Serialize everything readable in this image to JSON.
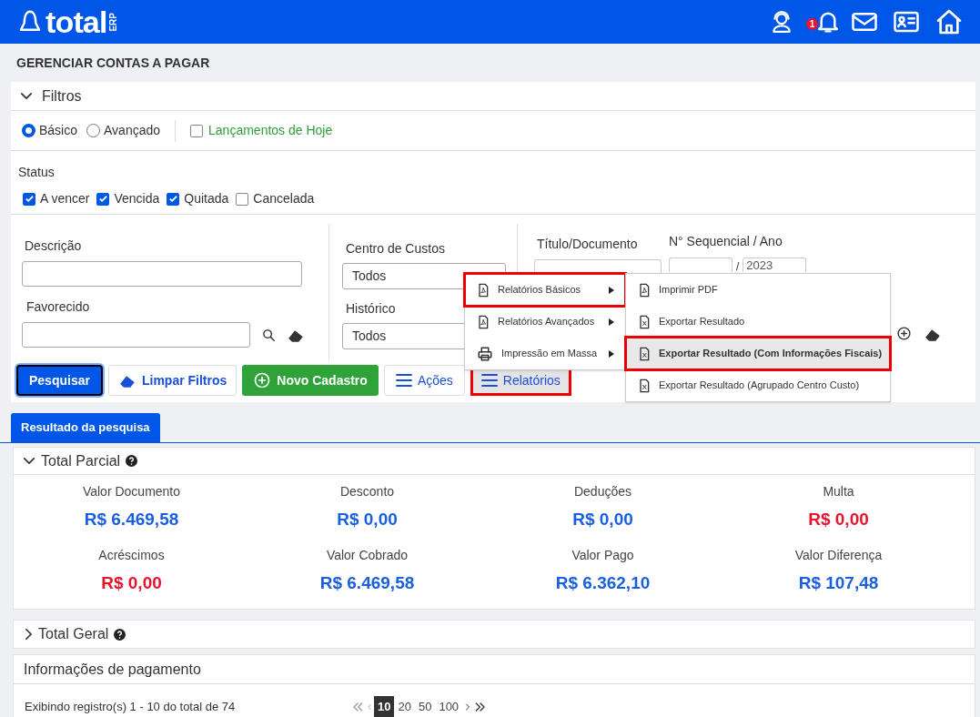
{
  "header": {
    "logo": "total",
    "logo_suffix": "ERP",
    "notification_count": "1"
  },
  "page_title": "GERENCIAR CONTAS A PAGAR",
  "filters": {
    "title": "Filtros",
    "expanded": true,
    "modes": [
      {
        "label": "Básico",
        "selected": true
      },
      {
        "label": "Avançado",
        "selected": false
      }
    ],
    "today": {
      "label": "Lançamentos de Hoje",
      "checked": false
    },
    "status_label": "Status",
    "statuses": [
      {
        "label": "A vencer",
        "checked": true
      },
      {
        "label": "Vencida",
        "checked": true
      },
      {
        "label": "Quitada",
        "checked": true
      },
      {
        "label": "Cancelada",
        "checked": false
      }
    ],
    "descricao": {
      "label": "Descrição"
    },
    "favorecido": {
      "label": "Favorecido"
    },
    "centro": {
      "label": "Centro de Custos",
      "value": "Todos"
    },
    "historico": {
      "label": "Histórico",
      "value": "Todos"
    },
    "titulo": {
      "label": "Título/Documento"
    },
    "sequencial": {
      "label": "N° Sequencial / Ano",
      "separator": "/",
      "year": "2023"
    }
  },
  "buttons": [
    {
      "kind": "primary",
      "label": "Pesquisar"
    },
    {
      "kind": "eraser",
      "label": "Limpar Filtros"
    },
    {
      "kind": "add",
      "label": "Novo Cadastro"
    },
    {
      "kind": "menu",
      "label": "Ações",
      "highlighted": false
    },
    {
      "kind": "menu_open",
      "label": "Relatórios",
      "highlighted": true
    }
  ],
  "menu": [
    {
      "kind": "pdf",
      "label": "Relatórios Básicos",
      "highlighted": true
    },
    {
      "kind": "pdf",
      "label": "Relatórios Avançados",
      "highlighted": false
    },
    {
      "kind": "print",
      "label": "Impressão em Massa",
      "highlighted": false
    }
  ],
  "submenu": [
    {
      "kind": "pdf",
      "label": "Imprimir PDF",
      "highlighted": false,
      "selected": false
    },
    {
      "kind": "xls",
      "label": "Exportar Resultado",
      "highlighted": false,
      "selected": false
    },
    {
      "kind": "xls",
      "label": "Exportar Resultado (Com Informações Fiscais)",
      "highlighted": true,
      "selected": true
    },
    {
      "kind": "xls",
      "label": "Exportar Resultado (Agrupado Centro Custo)",
      "highlighted": false,
      "selected": false
    }
  ],
  "result_tab": "Resultado da pesquisa",
  "total_parcial": {
    "title": "Total Parcial",
    "expanded": true,
    "metrics": [
      {
        "label": "Valor Documento",
        "value": "R$ 6.469,58",
        "color": "#1a5fe0"
      },
      {
        "label": "Desconto",
        "value": "R$ 0,00",
        "color": "#1a5fe0"
      },
      {
        "label": "Deduções",
        "value": "R$ 0,00",
        "color": "#1a5fe0"
      },
      {
        "label": "Multa",
        "value": "R$ 0,00",
        "color": "#e8142d"
      },
      {
        "label": "Acréscimos",
        "value": "R$ 0,00",
        "color": "#e8142d"
      },
      {
        "label": "Valor Cobrado",
        "value": "R$ 6.469,58",
        "color": "#1a5fe0"
      },
      {
        "label": "Valor Pago",
        "value": "R$ 6.362,10",
        "color": "#1a5fe0"
      },
      {
        "label": "Valor Diferença",
        "value": "R$ 107,48",
        "color": "#1a5fe0"
      }
    ]
  },
  "total_geral": {
    "title": "Total Geral",
    "expanded": false
  },
  "pagamento": {
    "title": "Informações de pagamento"
  },
  "pagination": {
    "summary": "Exibindo registro(s) 1 - 10 do total de 74",
    "sizes": [
      {
        "label": "10",
        "selected": true
      },
      {
        "label": "20",
        "selected": false
      },
      {
        "label": "50",
        "selected": false
      },
      {
        "label": "100",
        "selected": false
      }
    ]
  }
}
